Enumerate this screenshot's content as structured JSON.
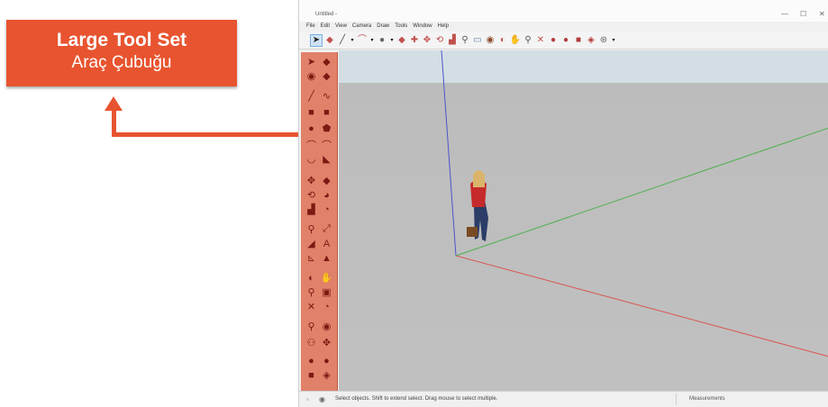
{
  "callout": {
    "title": "Large Tool Set",
    "subtitle": "Araç Çubuğu",
    "color": "#e8542f"
  },
  "window": {
    "title": "Untitled -",
    "controls": [
      "—",
      "☐",
      "✕"
    ],
    "menu": [
      "File",
      "Edit",
      "View",
      "Camera",
      "Draw",
      "Tools",
      "Window",
      "Help"
    ]
  },
  "toolbar_icons": [
    "select-icon",
    "eraser-icon",
    "line-icon",
    "dropdown",
    "arc-icon",
    "dropdown",
    "shape-icon",
    "dropdown",
    "push-pull-icon",
    "follow-me-icon",
    "move-icon",
    "rotate-icon",
    "scale-icon",
    "tape-icon",
    "dimension-icon",
    "paint-icon",
    "orbit-icon",
    "pan-icon",
    "zoom-icon",
    "zoom-extents-icon",
    "warehouse-icon",
    "extension-icon",
    "model-info-icon",
    "layout-icon",
    "account-icon",
    "dropdown"
  ],
  "status": {
    "text": "Select objects. Shift to extend select. Drag mouse to select multiple.",
    "measurements_label": "Measurements"
  },
  "axis_colors": {
    "x": "#d9534a",
    "y": "#4fb04f",
    "z": "#4b55c8"
  }
}
